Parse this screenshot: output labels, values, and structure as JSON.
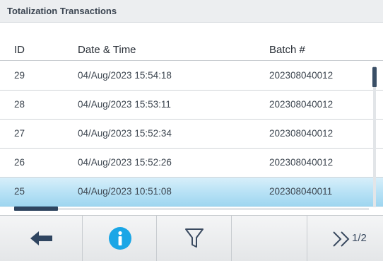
{
  "title": "Totalization Transactions",
  "columns": {
    "id": "ID",
    "datetime": "Date & Time",
    "batch": "Batch #"
  },
  "rows": [
    {
      "id": "29",
      "datetime": "04/Aug/2023  15:54:18",
      "batch": "202308040012"
    },
    {
      "id": "28",
      "datetime": "04/Aug/2023  15:53:11",
      "batch": "202308040012"
    },
    {
      "id": "27",
      "datetime": "04/Aug/2023  15:52:34",
      "batch": "202308040012"
    },
    {
      "id": "26",
      "datetime": "04/Aug/2023  15:52:26",
      "batch": "202308040012"
    },
    {
      "id": "25",
      "datetime": "04/Aug/2023  10:51:08",
      "batch": "202308040011",
      "selected": true
    }
  ],
  "softkeys": {
    "back": {
      "icon": "arrow-left-icon"
    },
    "info": {
      "icon": "info-icon"
    },
    "filter": {
      "icon": "filter-icon"
    },
    "empty": {},
    "next_page": {
      "icon": "double-chevron-right-icon",
      "page_label": "1/2"
    }
  },
  "colors": {
    "selected_row": "#b6e1f5",
    "info_icon": "#1aa6e6",
    "scroll_thumb": "#3a4f66"
  }
}
